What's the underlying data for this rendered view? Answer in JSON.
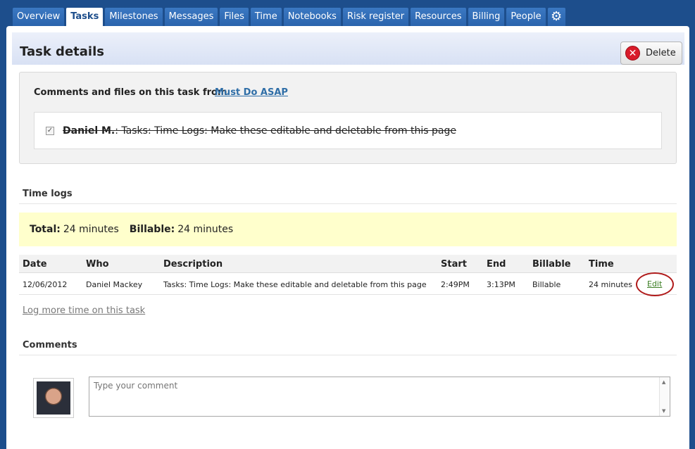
{
  "tabs": [
    {
      "label": "Overview"
    },
    {
      "label": "Tasks",
      "active": true
    },
    {
      "label": "Milestones"
    },
    {
      "label": "Messages"
    },
    {
      "label": "Files"
    },
    {
      "label": "Time"
    },
    {
      "label": "Notebooks"
    },
    {
      "label": "Risk register"
    },
    {
      "label": "Resources"
    },
    {
      "label": "Billing"
    },
    {
      "label": "People"
    }
  ],
  "settings_icon": "gear-icon",
  "header": {
    "title": "Task details",
    "delete_label": "Delete",
    "delete_icon": "close-circle-icon"
  },
  "comments_files": {
    "title": "Comments and files on this task from",
    "list_link": "Must Do ASAP",
    "task": {
      "assignee": "Daniel M.",
      "text": ": Tasks: Time Logs: Make these editable and deletable from this page",
      "completed": true
    }
  },
  "time_logs": {
    "title": "Time logs",
    "total_label": "Total:",
    "total_value": "24 minutes",
    "billable_label": "Billable:",
    "billable_value": "24 minutes",
    "columns": [
      "Date",
      "Who",
      "Description",
      "Start",
      "End",
      "Billable",
      "Time"
    ],
    "rows": [
      {
        "date": "12/06/2012",
        "who": "Daniel Mackey",
        "description": "Tasks: Time Logs: Make these editable and deletable from this page",
        "start": "2:49PM",
        "end": "3:13PM",
        "billable": "Billable",
        "time": "24 minutes",
        "action": "Edit"
      }
    ],
    "log_more_link": "Log more time on this task"
  },
  "comments": {
    "title": "Comments",
    "placeholder": "Type your comment"
  },
  "colors": {
    "nav_bg": "#1d4e8c",
    "tab_bg": "#2a64ad",
    "header_bg": "#d8e1f4",
    "totals_bg": "#ffffcc",
    "link": "#2f6ea7",
    "edit_link": "#3a7d22",
    "highlight_ring": "#b01a1a",
    "delete_icon": "#d91c2a"
  }
}
